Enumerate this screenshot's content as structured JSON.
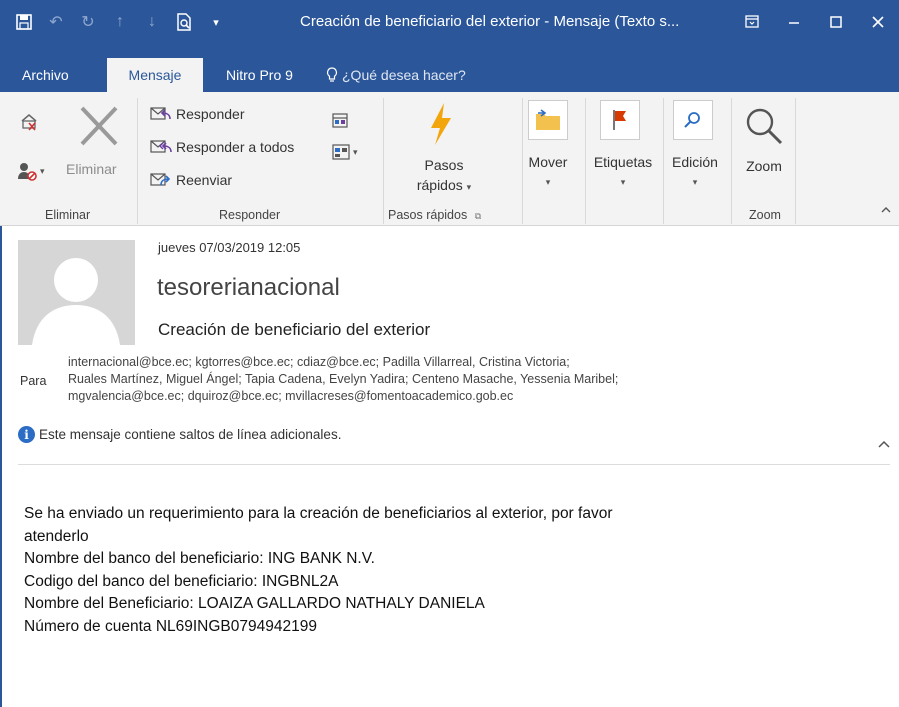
{
  "window": {
    "title": "Creación de beneficiario del exterior - Mensaje (Texto s..."
  },
  "tabs": [
    {
      "label": "Archivo"
    },
    {
      "label": "Mensaje"
    },
    {
      "label": "Nitro Pro 9"
    }
  ],
  "tell_me": {
    "label": "¿Qué desea hacer?"
  },
  "ribbon": {
    "eliminar_group": {
      "delete_label": "Eliminar",
      "group_label": "Eliminar"
    },
    "responder_group": {
      "reply": "Responder",
      "reply_all": "Responder a todos",
      "forward": "Reenviar",
      "group_label": "Responder"
    },
    "quick_steps": {
      "line1": "Pasos",
      "line2": "rápidos",
      "group_label": "Pasos rápidos"
    },
    "move": {
      "label": "Mover"
    },
    "tags": {
      "label": "Etiquetas"
    },
    "edit": {
      "label": "Edición"
    },
    "zoom": {
      "label": "Zoom",
      "group_label": "Zoom"
    }
  },
  "message": {
    "date": "jueves 07/03/2019 12:05",
    "sender": "tesorerianacional",
    "subject": "Creación de beneficiario del exterior",
    "to_label": "Para",
    "recipients": [
      "internacional@bce.ec; kgtorres@bce.ec; cdiaz@bce.ec; Padilla Villarreal, Cristina Victoria;",
      "Ruales Martínez, Miguel Ángel; Tapia Cadena, Evelyn Yadira; Centeno Masache, Yessenia Maribel;",
      "mgvalencia@bce.ec; dquiroz@bce.ec; mvillacreses@fomentoacademico.gob.ec"
    ],
    "info": "Este mensaje contiene saltos de línea adicionales.",
    "body": [
      "Se ha enviado un requerimiento para  la creación de beneficiarios al exterior, por favor",
      "atenderlo",
      "Nombre del banco del beneficiario: ING BANK N.V.",
      "Codigo del banco del beneficiario: INGBNL2A",
      "Nombre del Beneficiario: LOAIZA GALLARDO NATHALY DANIELA",
      "Número de cuenta NL69INGB0794942199"
    ]
  },
  "colors": {
    "accent": "#2b579a",
    "ribbon_bg": "#f3f3f3",
    "flag": "#d83b01",
    "lightning": "#f2a60c"
  }
}
